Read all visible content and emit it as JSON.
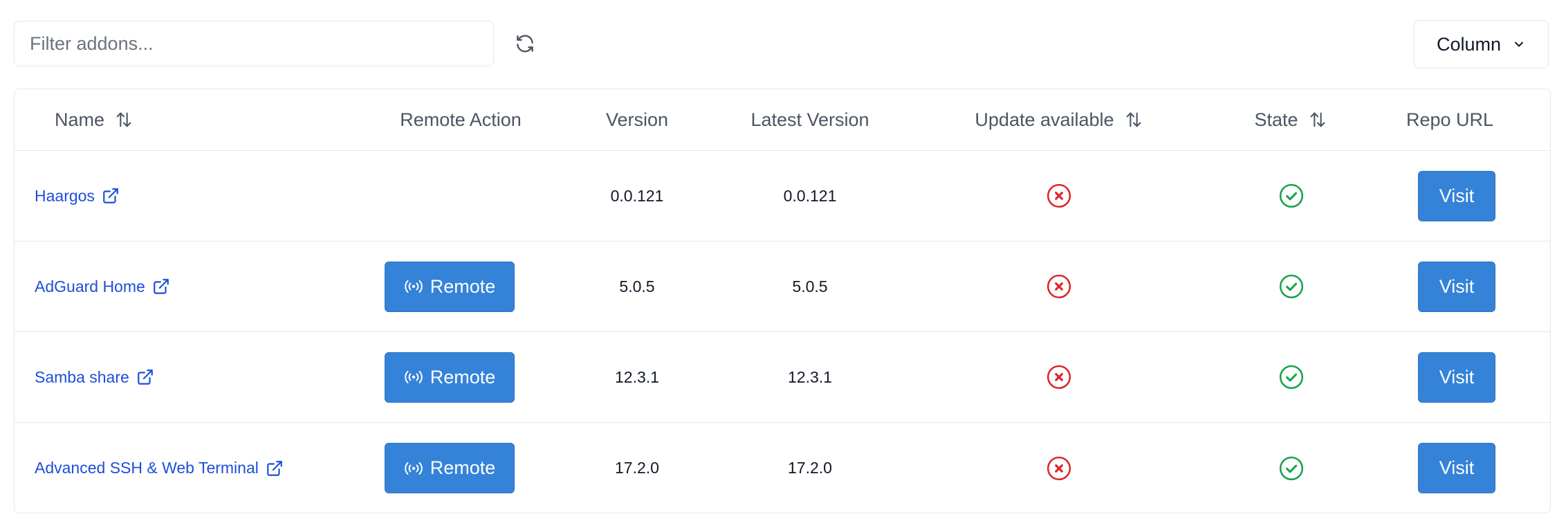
{
  "toolbar": {
    "filter_placeholder": "Filter addons...",
    "filter_value": "",
    "refresh_icon": "refresh-icon",
    "column_label": "Column",
    "column_icon": "chevron-down-icon"
  },
  "table": {
    "headers": {
      "name": "Name",
      "remote_action": "Remote Action",
      "version": "Version",
      "latest_version": "Latest Version",
      "update_available": "Update available",
      "state": "State",
      "repo_url": "Repo URL"
    },
    "rows": [
      {
        "name": "Haargos",
        "has_remote": false,
        "remote_label": "",
        "version": "0.0.121",
        "latest_version": "0.0.121",
        "update_available": false,
        "state": true,
        "visit_label": "Visit"
      },
      {
        "name": "AdGuard Home",
        "has_remote": true,
        "remote_label": "Remote",
        "version": "5.0.5",
        "latest_version": "5.0.5",
        "update_available": false,
        "state": true,
        "visit_label": "Visit"
      },
      {
        "name": "Samba share",
        "has_remote": true,
        "remote_label": "Remote",
        "version": "12.3.1",
        "latest_version": "12.3.1",
        "update_available": false,
        "state": true,
        "visit_label": "Visit"
      },
      {
        "name": "Advanced SSH & Web Terminal",
        "has_remote": true,
        "remote_label": "Remote",
        "version": "17.2.0",
        "latest_version": "17.2.0",
        "update_available": false,
        "state": true,
        "visit_label": "Visit"
      }
    ]
  },
  "colors": {
    "link": "#1d4ed8",
    "button": "#3483d9",
    "error": "#dc2626",
    "success": "#16a34a",
    "border": "#e5e7eb"
  },
  "icons": {
    "external_link": "external-link-icon",
    "sort": "sort-icon",
    "remote": "broadcast-icon",
    "no_update": "x-circle-icon",
    "state_ok": "check-circle-icon"
  }
}
